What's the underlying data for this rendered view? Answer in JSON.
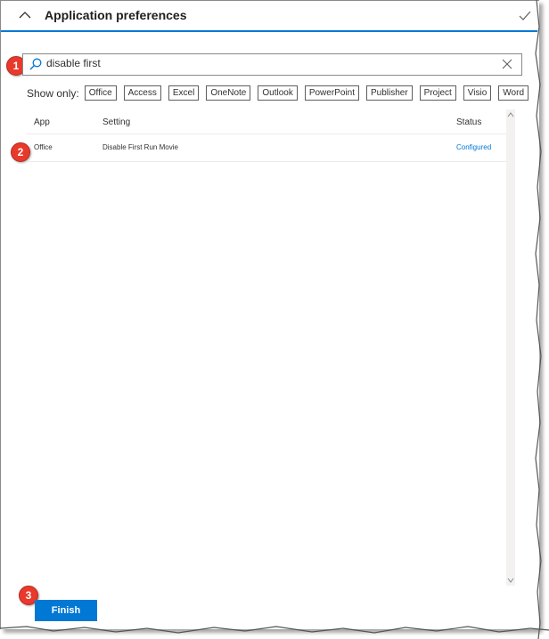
{
  "header": {
    "title": "Application preferences"
  },
  "search": {
    "value": "disable first"
  },
  "callouts": [
    "1",
    "2",
    "3"
  ],
  "filters": {
    "label": "Show only:",
    "options": [
      "Office",
      "Access",
      "Excel",
      "OneNote",
      "Outlook",
      "PowerPoint",
      "Publisher",
      "Project",
      "Visio",
      "Word"
    ]
  },
  "table": {
    "columns": {
      "app": "App",
      "setting": "Setting",
      "status": "Status"
    },
    "rows": [
      {
        "app": "Office",
        "setting": "Disable First Run Movie",
        "status": "Configured"
      }
    ]
  },
  "footer": {
    "finish_label": "Finish"
  },
  "colors": {
    "accent": "#0078d4",
    "callout": "#e8392c"
  }
}
